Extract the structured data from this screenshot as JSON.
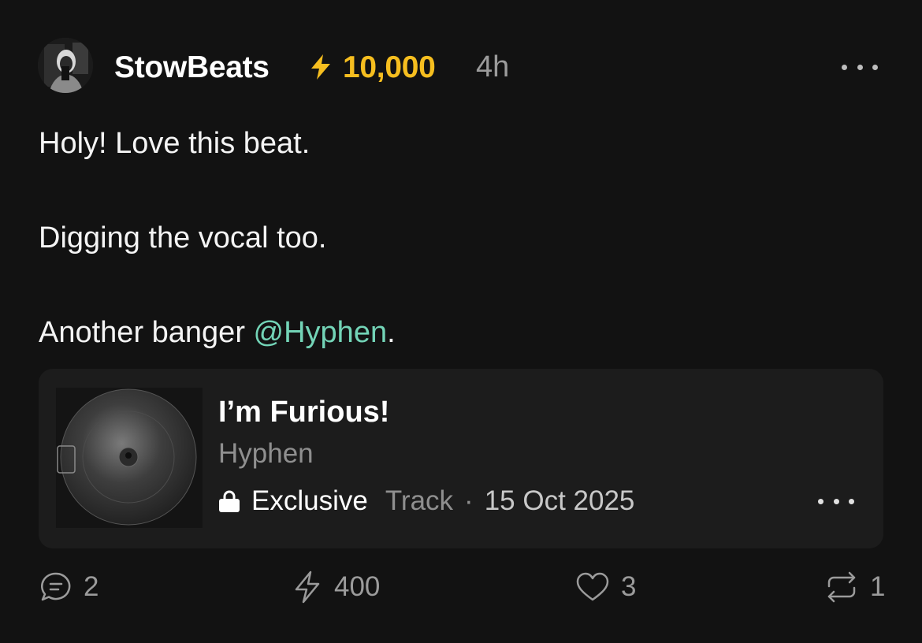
{
  "post": {
    "username": "StowBeats",
    "score": "10,000",
    "time": "4h",
    "lines": {
      "line1": "Holy! Love this beat.",
      "line2": "Digging the vocal too.",
      "line3_prefix": "Another banger ",
      "mention": "@Hyphen",
      "line3_suffix": "."
    }
  },
  "track": {
    "title": "I’m Furious!",
    "artist": "Hyphen",
    "exclusive_label": "Exclusive",
    "type": "Track",
    "separator": "·",
    "date": "15 Oct 2025"
  },
  "actions": {
    "comments": "2",
    "boosts": "400",
    "likes": "3",
    "reposts": "1"
  },
  "colors": {
    "background": "#121212",
    "card": "#1c1c1c",
    "score_accent": "#f6be1f",
    "mention": "#73d4b7"
  },
  "icons": {
    "score": "lightning-bolt-icon",
    "more": "more-horizontal-icon",
    "lock": "lock-icon",
    "comment": "comment-icon",
    "boost": "lightning-outline-icon",
    "like": "heart-icon",
    "repost": "repost-icon"
  }
}
